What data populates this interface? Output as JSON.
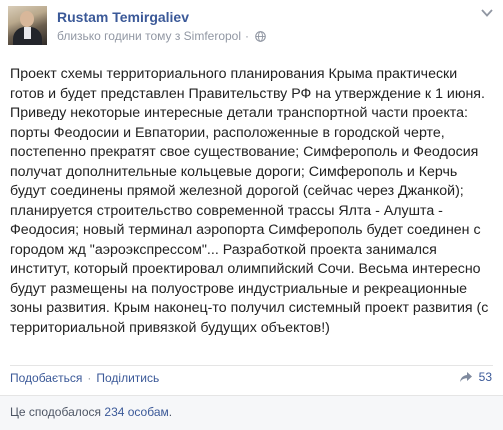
{
  "author": {
    "name": "Rustam Temirgaliev",
    "timestamp": "близько години тому з Simferopol",
    "privacy_icon": "globe-icon"
  },
  "post": {
    "text": "Проект схемы территориального планирования Крыма практически готов и будет представлен Правительству РФ на утверждение к 1 июня. Приведу некоторые интересные детали транспортной части проекта: порты Феодосии и Евпатории, расположенные в городской черте, постепенно прекратят свое существование; Симферополь и Феодосия получат дополнительные кольцевые дороги; Симферополь и Керчь будут соединены прямой железной дорогой (сейчас через Джанкой); планируется строительство современной трассы Ялта - Алушта - Феодосия; новый терминал аэропорта Симферополь будет соединен с городом жд \"аэроэкспрессом\"... Разработкой проекта занимался институт, который проектировал олимпийский Сочи. Весьма интересно будут размещены на полуострове индустриальные и рекреационные зоны развития. Крым наконец-то получил системный проект развития (с территориальной привязкой будущих объектов!)"
  },
  "actions": {
    "like_label": "Подобається",
    "separator": "·",
    "share_label": "Поділитись",
    "shares_count": "53"
  },
  "likes": {
    "prefix": "Це сподобалося ",
    "count": "234 особам",
    "suffix": "."
  },
  "colors": {
    "link": "#3b5998",
    "meta": "#9197a3",
    "likes_bg": "#f6f7f9"
  }
}
